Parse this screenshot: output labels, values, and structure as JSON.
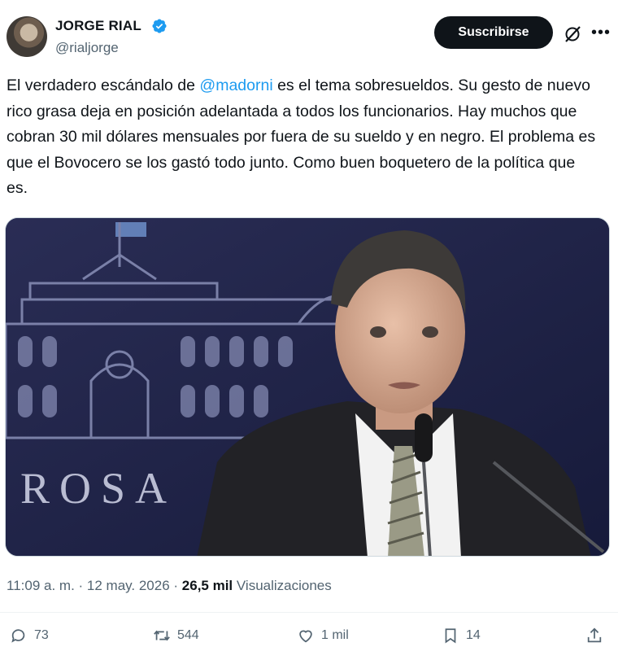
{
  "author": {
    "name": "JORGE RIAL",
    "handle": "@rialjorge",
    "verified_icon": "verified-badge-icon",
    "verified_color": "#1d9bf0"
  },
  "header": {
    "subscribe_label": "Suscribirse",
    "grok_icon": "grok-icon",
    "more_icon": "more-icon"
  },
  "tweet": {
    "text_before_mention": "El verdadero escándalo de ",
    "mention": "@madorni",
    "text_after_mention": " es el tema sobresueldos. Su gesto de nuevo rico grasa deja en posición adelantada a todos los funcionarios. Hay muchos que cobran 30 mil dólares mensuales por fuera de su sueldo y en negro. El problema es que el Bovocero se los gastó todo junto. Como buen boquetero de la política que es.",
    "mention_color": "#1d9bf0"
  },
  "media": {
    "background_text": "ROSA"
  },
  "meta": {
    "time": "11:09 a. m.",
    "separator": " · ",
    "date": "12 may. 2026",
    "views_count": "26,5 mil",
    "views_label": "Visualizaciones"
  },
  "actions": {
    "replies": "73",
    "reposts": "544",
    "likes": "1 mil",
    "bookmarks": "14"
  }
}
